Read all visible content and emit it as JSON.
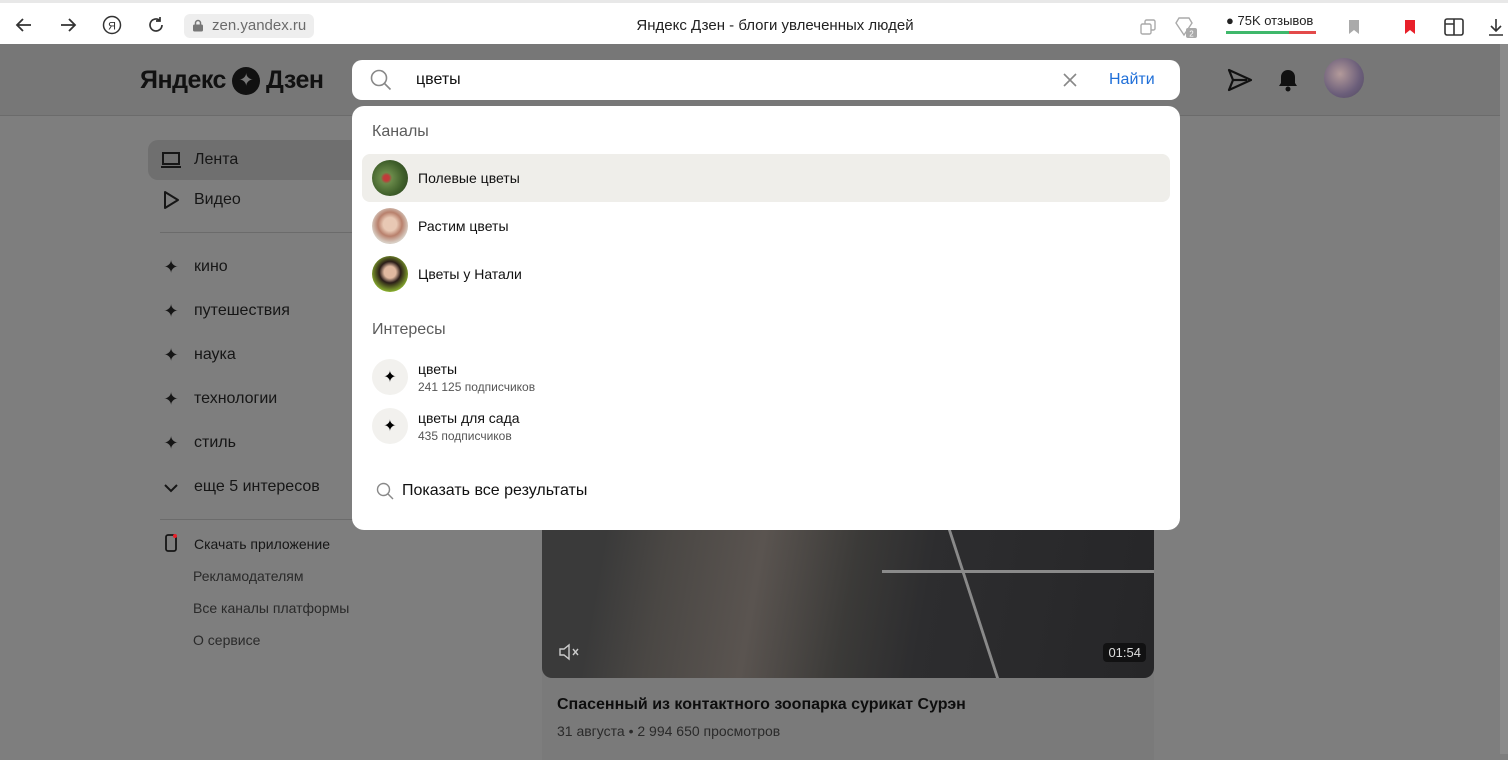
{
  "browser": {
    "url": "zen.yandex.ru",
    "title": "Яндекс Дзен - блоги увлеченных людей",
    "reviews": "75K отзывов",
    "tab_count": "2"
  },
  "header": {
    "logo_text_1": "Яндекс",
    "logo_text_2": "Дзен"
  },
  "search": {
    "value": "цветы",
    "go_label": "Найти"
  },
  "dropdown": {
    "channels_heading": "Каналы",
    "channels": [
      {
        "name": "Полевые цветы"
      },
      {
        "name": "Растим цветы"
      },
      {
        "name": "Цветы у Натали"
      }
    ],
    "interests_heading": "Интересы",
    "interests": [
      {
        "name": "цветы",
        "subs": "241 125 подписчиков"
      },
      {
        "name": "цветы для сада",
        "subs": "435 подписчиков"
      }
    ],
    "show_all": "Показать все результаты"
  },
  "sidebar": {
    "nav": [
      {
        "label": "Лента"
      },
      {
        "label": "Видео"
      }
    ],
    "interests": [
      {
        "label": "кино"
      },
      {
        "label": "путешествия"
      },
      {
        "label": "наука"
      },
      {
        "label": "технологии"
      },
      {
        "label": "стиль"
      }
    ],
    "more_interests": "еще 5 интересов",
    "download_app": "Скачать приложение",
    "links": [
      {
        "label": "Рекламодателям"
      },
      {
        "label": "Все каналы платформы"
      },
      {
        "label": "О сервисе"
      }
    ]
  },
  "card": {
    "duration": "01:54",
    "title": "Спасенный из контактного зоопарка сурикат Сурэн",
    "meta": "31 августа • 2 994 650 просмотров"
  }
}
